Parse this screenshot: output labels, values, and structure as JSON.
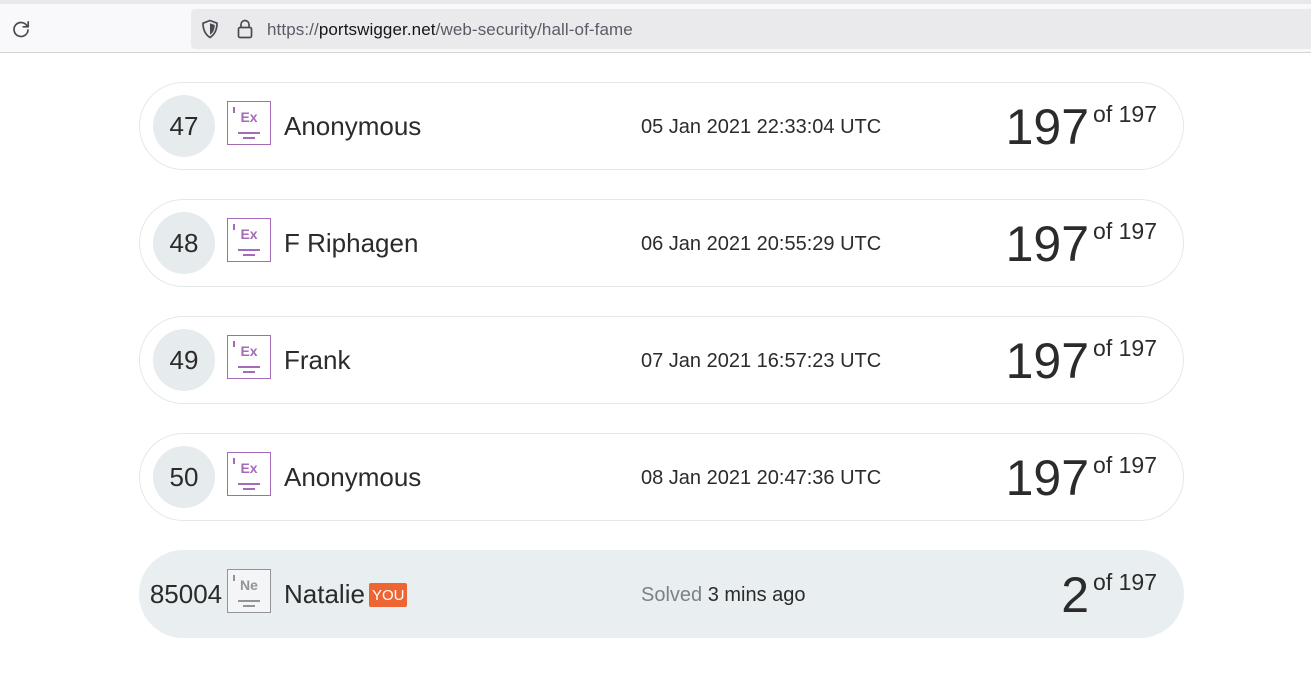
{
  "browser": {
    "url_protocol": "https://",
    "url_host": "portswigger.net",
    "url_path": "/web-security/hall-of-fame"
  },
  "rows": [
    {
      "rank": "47",
      "badge": "Ex",
      "name": "Anonymous",
      "time": "05 Jan 2021 22:33:04 UTC",
      "score": "197",
      "of": "of 197"
    },
    {
      "rank": "48",
      "badge": "Ex",
      "name": "F Riphagen",
      "time": "06 Jan 2021 20:55:29 UTC",
      "score": "197",
      "of": "of 197"
    },
    {
      "rank": "49",
      "badge": "Ex",
      "name": "Frank",
      "time": "07 Jan 2021 16:57:23 UTC",
      "score": "197",
      "of": "of 197"
    },
    {
      "rank": "50",
      "badge": "Ex",
      "name": "Anonymous",
      "time": "08 Jan 2021 20:47:36 UTC",
      "score": "197",
      "of": "of 197"
    }
  ],
  "you_row": {
    "rank": "85004",
    "badge": "Ne",
    "name": "Natalie",
    "you_label": "YOU",
    "solved_label": "Solved",
    "time": "3 mins ago",
    "score": "2",
    "of": "of 197"
  },
  "colors": {
    "expert_badge": "#a66bb8",
    "novice_badge": "#8f9599",
    "you_tag": "#ee6533",
    "you_row_bg": "#e9eef0"
  }
}
